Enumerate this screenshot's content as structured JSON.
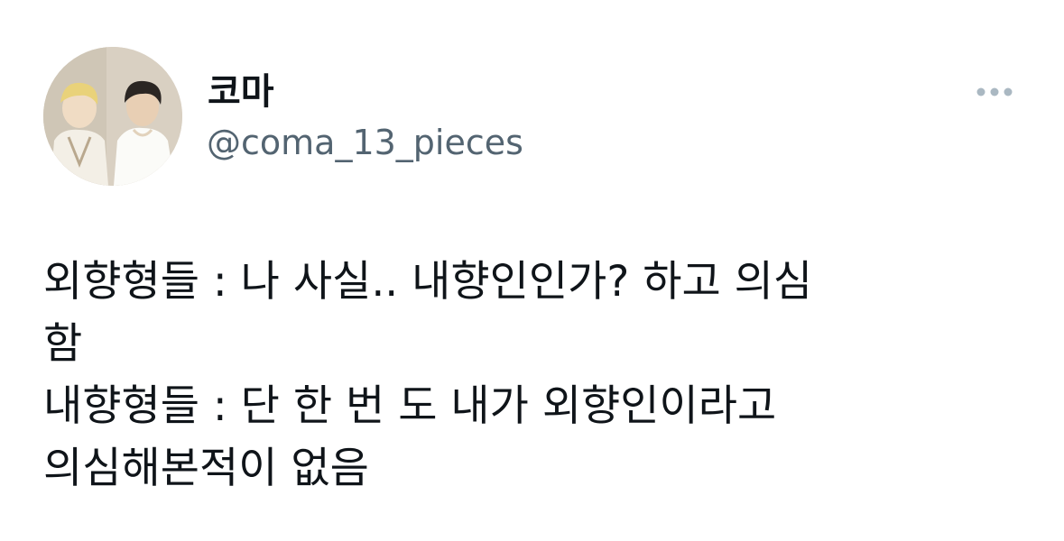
{
  "user": {
    "display_name": "코마",
    "handle": "@coma_13_pieces",
    "avatar_icon": "profile-photo"
  },
  "more_icon": "more-horizontal-icon",
  "tweet": {
    "lines": [
      "외향형들 : 나 사실.. 내향인인가? 하고 의심",
      "함",
      "내향형들 : 단 한 번 도 내가 외향인이라고",
      "의심해본적이 없음"
    ]
  },
  "colors": {
    "text": "#0f1419",
    "secondary": "#536471",
    "icon": "#aab8c2",
    "background": "#ffffff"
  }
}
